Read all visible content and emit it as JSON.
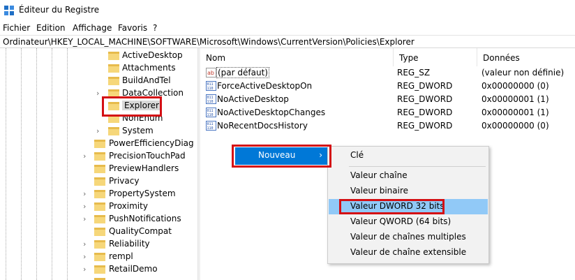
{
  "window": {
    "title": "Éditeur du Registre"
  },
  "menu": [
    {
      "label": "Fichier"
    },
    {
      "label": "Edition"
    },
    {
      "label": "Affichage"
    },
    {
      "label": "Favoris"
    },
    {
      "label": "?"
    }
  ],
  "address": {
    "path": "Ordinateur\\HKEY_LOCAL_MACHINE\\SOFTWARE\\Microsoft\\Windows\\CurrentVersion\\Policies\\Explorer"
  },
  "tree": {
    "sub_keys": [
      {
        "label": "ActiveDesktop",
        "expandable": false
      },
      {
        "label": "Attachments",
        "expandable": false
      },
      {
        "label": "BuildAndTel",
        "expandable": false
      },
      {
        "label": "DataCollection",
        "expandable": true
      },
      {
        "label": "Explorer",
        "expandable": false,
        "selected": true
      },
      {
        "label": "NonEnum",
        "expandable": false
      },
      {
        "label": "System",
        "expandable": true
      }
    ],
    "keys": [
      {
        "label": "PowerEfficiencyDiag",
        "expandable": false
      },
      {
        "label": "PrecisionTouchPad",
        "expandable": true
      },
      {
        "label": "PreviewHandlers",
        "expandable": false
      },
      {
        "label": "Privacy",
        "expandable": false
      },
      {
        "label": "PropertySystem",
        "expandable": true
      },
      {
        "label": "Proximity",
        "expandable": true
      },
      {
        "label": "PushNotifications",
        "expandable": true
      },
      {
        "label": "QualityCompat",
        "expandable": false
      },
      {
        "label": "Reliability",
        "expandable": true
      },
      {
        "label": "rempl",
        "expandable": true
      },
      {
        "label": "RetailDemo",
        "expandable": true
      }
    ]
  },
  "list": {
    "headers": {
      "name": "Nom",
      "type": "Type",
      "data": "Données"
    },
    "rows": [
      {
        "icon": "string-value-icon",
        "name": "(par défaut)",
        "type": "REG_SZ",
        "data": "(valeur non définie)"
      },
      {
        "icon": "dword-value-icon",
        "name": "ForceActiveDesktopOn",
        "type": "REG_DWORD",
        "data": "0x00000000 (0)"
      },
      {
        "icon": "dword-value-icon",
        "name": "NoActiveDesktop",
        "type": "REG_DWORD",
        "data": "0x00000001 (1)"
      },
      {
        "icon": "dword-value-icon",
        "name": "NoActiveDesktopChanges",
        "type": "REG_DWORD",
        "data": "0x00000001 (1)"
      },
      {
        "icon": "dword-value-icon",
        "name": "NoRecentDocsHistory",
        "type": "REG_DWORD",
        "data": "0x00000000 (0)"
      }
    ]
  },
  "context_menu": {
    "item": {
      "label": "Nouveau",
      "arrow": "›"
    },
    "submenu": [
      {
        "label": "Clé"
      },
      {
        "label": "Valeur chaîne"
      },
      {
        "label": "Valeur binaire"
      },
      {
        "label": "Valeur DWORD 32 bits",
        "highlighted": true
      },
      {
        "label": "Valeur QWORD (64 bits)"
      },
      {
        "label": "Valeur de chaînes multiples"
      },
      {
        "label": "Valeur de chaîne extensible"
      }
    ]
  },
  "colors": {
    "accent": "#0078d7",
    "highlight": "#91c9f7",
    "annotation": "#d40f14",
    "folder": "#f6d77a"
  }
}
